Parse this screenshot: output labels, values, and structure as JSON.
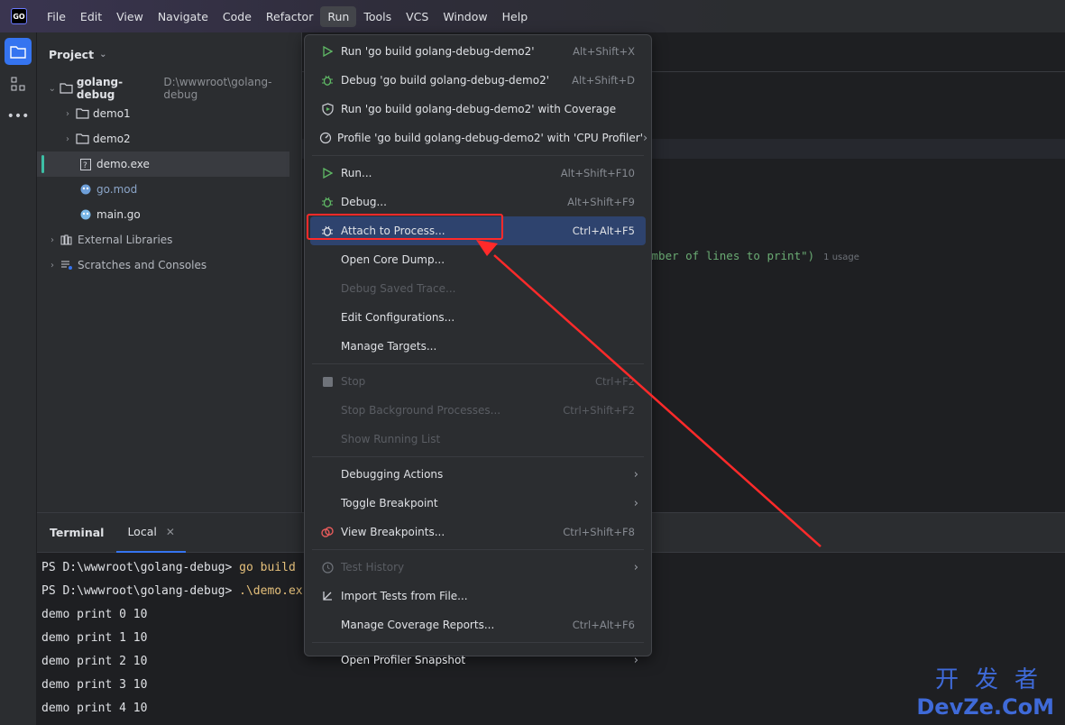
{
  "app": {
    "logo_text": "GO"
  },
  "menubar": [
    {
      "label": "File"
    },
    {
      "label": "Edit"
    },
    {
      "label": "View"
    },
    {
      "label": "Navigate"
    },
    {
      "label": "Code"
    },
    {
      "label": "Refactor"
    },
    {
      "label": "Run"
    },
    {
      "label": "Tools"
    },
    {
      "label": "VCS"
    },
    {
      "label": "Window"
    },
    {
      "label": "Help"
    }
  ],
  "project": {
    "title": "Project",
    "root": {
      "name": "golang-debug",
      "path": "D:\\wwwroot\\golang-debug"
    },
    "items": [
      {
        "name": "demo1"
      },
      {
        "name": "demo2"
      },
      {
        "name": "demo.exe"
      },
      {
        "name": "go.mod"
      },
      {
        "name": "main.go"
      }
    ],
    "external": "External Libraries",
    "scratches": "Scratches and Consoles"
  },
  "editor": {
    "code_fragment": "umber of lines to print\")",
    "usage_hint": "1 usage"
  },
  "run_menu": [
    {
      "label": "Run 'go build golang-debug-demo2'",
      "shortcut": "Alt+Shift+X",
      "icon": "run-icon"
    },
    {
      "label": "Debug 'go build golang-debug-demo2'",
      "shortcut": "Alt+Shift+D",
      "icon": "debug-icon"
    },
    {
      "label": "Run 'go build golang-debug-demo2' with Coverage",
      "shortcut": "",
      "icon": "coverage-icon"
    },
    {
      "label": "Profile 'go build golang-debug-demo2' with 'CPU Profiler'",
      "shortcut": "",
      "icon": "profiler-icon",
      "submenu": true
    },
    {
      "label": "Run...",
      "shortcut": "Alt+Shift+F10",
      "icon": "run-icon"
    },
    {
      "label": "Debug...",
      "shortcut": "Alt+Shift+F9",
      "icon": "debug-icon"
    },
    {
      "label": "Attach to Process...",
      "shortcut": "Ctrl+Alt+F5",
      "icon": "attach-icon",
      "highlighted": true
    },
    {
      "label": "Open Core Dump...",
      "shortcut": ""
    },
    {
      "label": "Debug Saved Trace...",
      "shortcut": "",
      "disabled": true
    },
    {
      "label": "Edit Configurations...",
      "shortcut": ""
    },
    {
      "label": "Manage Targets...",
      "shortcut": ""
    },
    {
      "label": "Stop",
      "shortcut": "Ctrl+F2",
      "icon": "stop-icon",
      "disabled": true
    },
    {
      "label": "Stop Background Processes...",
      "shortcut": "Ctrl+Shift+F2",
      "disabled": true
    },
    {
      "label": "Show Running List",
      "shortcut": "",
      "disabled": true
    },
    {
      "label": "Debugging Actions",
      "shortcut": "",
      "submenu": true
    },
    {
      "label": "Toggle Breakpoint",
      "shortcut": "",
      "submenu": true
    },
    {
      "label": "View Breakpoints...",
      "shortcut": "Ctrl+Shift+F8",
      "icon": "breakpoints-icon"
    },
    {
      "label": "Test History",
      "shortcut": "",
      "icon": "history-icon",
      "disabled": true,
      "submenu": true
    },
    {
      "label": "Import Tests from File...",
      "shortcut": "",
      "icon": "import-icon"
    },
    {
      "label": "Manage Coverage Reports...",
      "shortcut": "Ctrl+Alt+F6"
    },
    {
      "label": "Open Profiler Snapshot",
      "shortcut": "",
      "submenu": true
    }
  ],
  "terminal": {
    "title": "Terminal",
    "tab": "Local",
    "lines": [
      {
        "prompt": "PS D:\\wwwroot\\golang-debug> ",
        "cmd": "go build"
      },
      {
        "prompt": "PS D:\\wwwroot\\golang-debug> ",
        "cmd": ".\\demo.ex"
      },
      {
        "prompt": "demo print 0 10",
        "cmd": ""
      },
      {
        "prompt": "demo print 1 10",
        "cmd": ""
      },
      {
        "prompt": "demo print 2 10",
        "cmd": ""
      },
      {
        "prompt": "demo print 3 10",
        "cmd": ""
      },
      {
        "prompt": "demo print 4 10",
        "cmd": ""
      }
    ]
  },
  "watermark": {
    "cn": "开发者",
    "en": "DevZe.CoM"
  },
  "colors": {
    "accent": "#3574f0",
    "highlight": "#2e436e",
    "annotation": "#ff2a2a"
  }
}
